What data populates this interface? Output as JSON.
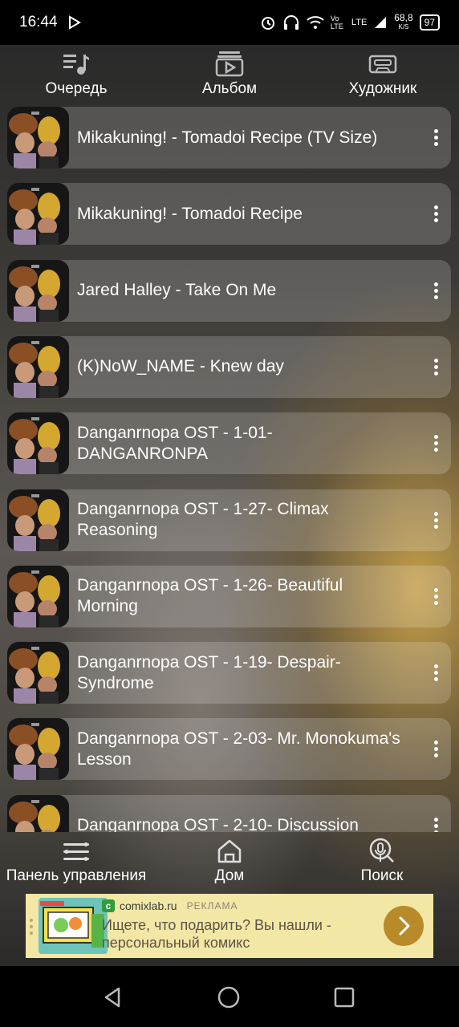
{
  "status": {
    "time": "16:44",
    "net_speed": "68,8",
    "net_unit": "K/S",
    "battery": "97",
    "volte": "Vo LTE",
    "lte": "LTE"
  },
  "tabs": [
    {
      "label": "Очередь",
      "icon": "queue-music-icon"
    },
    {
      "label": "Альбом",
      "icon": "album-icon"
    },
    {
      "label": "Художник",
      "icon": "artist-cassette-icon"
    }
  ],
  "songs": [
    {
      "title": "Mikakuning! - Tomadoi Recipe (TV Size)"
    },
    {
      "title": "Mikakuning! - Tomadoi Recipe"
    },
    {
      "title": "Jared Halley - Take On Me"
    },
    {
      "title": "(K)NoW_NAME - Knew day"
    },
    {
      "title": "Danganrnopa OST - 1-01- DANGANRONPA"
    },
    {
      "title": "Danganrnopa OST - 1-27- Climax Reasoning"
    },
    {
      "title": "Danganrnopa OST - 1-26- Beautiful Morning"
    },
    {
      "title": "Danganrnopa OST - 1-19- Despair-Syndrome"
    },
    {
      "title": "Danganrnopa OST - 2-03- Mr. Monokuma's Lesson"
    },
    {
      "title": "Danganrnopa OST - 2-10- Discussion"
    }
  ],
  "bottom_nav": [
    {
      "label": "Панель управления",
      "icon": "control-panel-icon"
    },
    {
      "label": "Дом",
      "icon": "home-icon"
    },
    {
      "label": "Поиск",
      "icon": "voice-search-icon"
    }
  ],
  "ad": {
    "source": "comixlab.ru",
    "tag": "РЕКЛАМА",
    "text": "Ищете, что подарить? Вы нашли - персональный комикс"
  }
}
